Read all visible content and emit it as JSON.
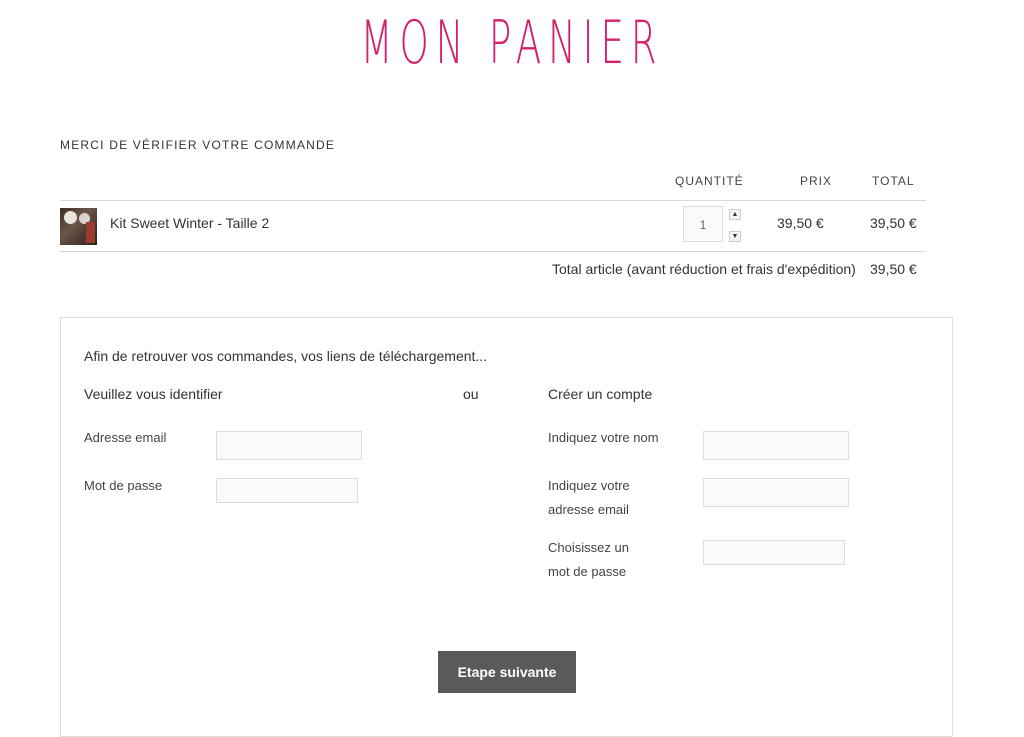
{
  "page_title": "MON PANIER",
  "verify_heading": "MERCI DE VÉRIFIER VOTRE COMMANDE",
  "cart": {
    "columns": {
      "quantity": "QUANTITÉ",
      "price": "PRIX",
      "total": "TOTAL"
    },
    "items": [
      {
        "name": "Kit Sweet Winter - Taille 2",
        "quantity": "1",
        "price": "39,50 €",
        "total": "39,50 €"
      }
    ],
    "subtotal_label": "Total article (avant réduction et frais d'expédition)",
    "subtotal_value": "39,50 €"
  },
  "account": {
    "intro": "Afin de retrouver vos commandes, vos liens de téléchargement...",
    "login_heading": "Veuillez vous identifier",
    "or_label": "ou",
    "create_heading": "Créer un compte",
    "login_email_label": "Adresse email",
    "login_password_label": "Mot de passe",
    "create_name_label": "Indiquez votre nom",
    "create_email_label_1": "Indiquez votre",
    "create_email_label_2": "adresse email",
    "create_password_label_1": "Choisissez un",
    "create_password_label_2": "mot de passe",
    "login_email_value": "",
    "login_password_value": "",
    "create_name_value": "",
    "create_email_value": "",
    "create_password_value": ""
  },
  "next_button_label": "Etape suivante",
  "icons": {
    "quantity_up": "triangle-up-icon",
    "quantity_down": "triangle-down-icon"
  },
  "colors": {
    "title": "#d61f6a",
    "button": "#5a5a5a"
  }
}
